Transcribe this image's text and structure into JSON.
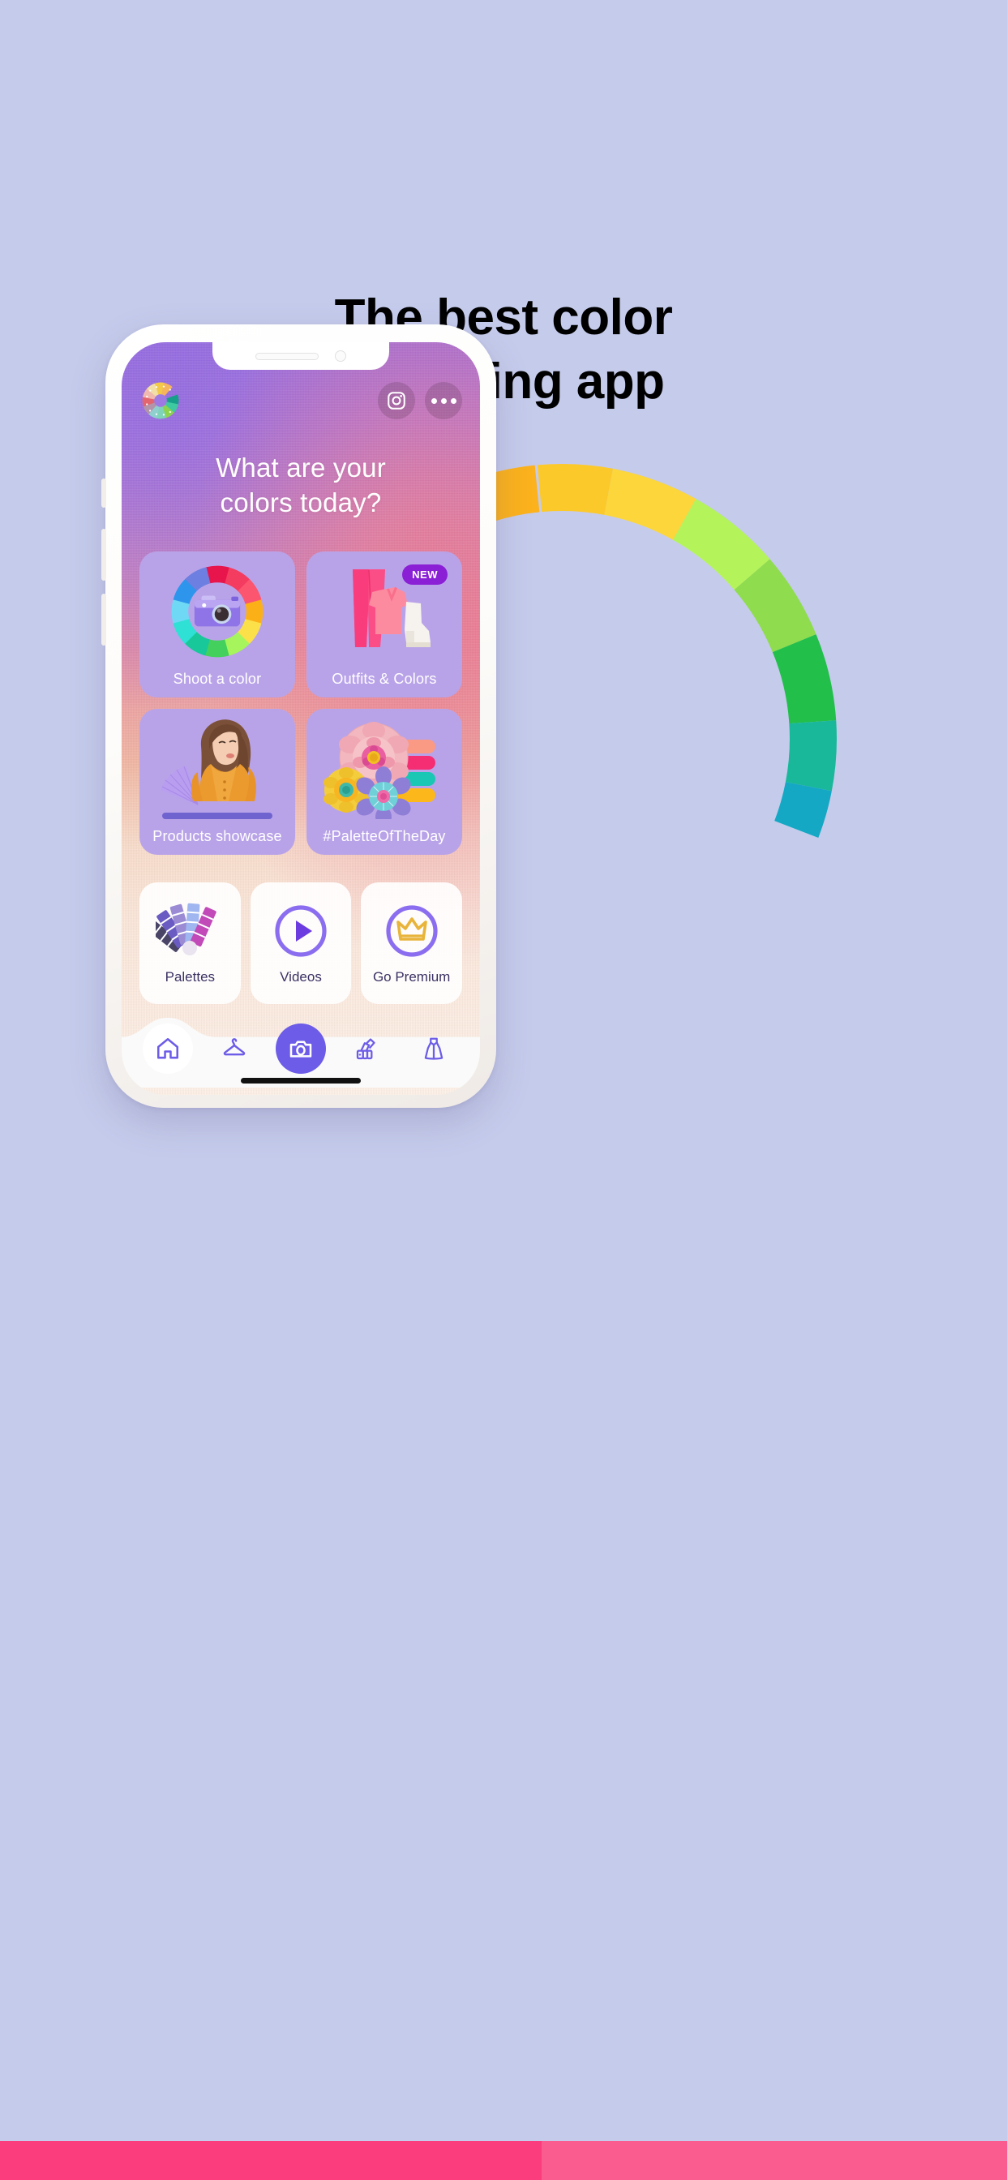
{
  "page": {
    "background_color": "#c5cbeb",
    "headline": "The best color\nmatching app"
  },
  "bottom_strip": {
    "left_color": "#fb3c7d",
    "right_color": "#fb5c90"
  },
  "wheel_arc": {
    "name": "color-wheel-arc",
    "segments": [
      "#e6175b",
      "#f4236e",
      "#fb3c7d",
      "#fcb21c",
      "#fcc92b",
      "#fcd63b",
      "#b4f45a",
      "#8fdc4e",
      "#22bf4b",
      "#19b89a",
      "#14a8c4"
    ]
  },
  "phone": {
    "notch": {
      "speaker": "speaker-grille",
      "camera": "front-camera"
    },
    "screen": {
      "topbar": {
        "logo_name": "color-wheel-logo",
        "instagram_label": "Instagram",
        "more_label": "More options"
      },
      "hero_title": "What are your\ncolors today?",
      "tiles": [
        {
          "label": "Shoot a color",
          "icon": "color-wheel-camera-icon",
          "badge": null
        },
        {
          "label": "Outfits & Colors",
          "icon": "outfit-icon",
          "badge": "NEW"
        },
        {
          "label": "Products showcase",
          "icon": "model-photo-icon",
          "badge": null
        },
        {
          "label": "#PaletteOfTheDay",
          "icon": "paper-flowers-icon",
          "badge": null
        }
      ],
      "mini_cards": [
        {
          "label": "Palettes",
          "icon": "palette-fandeck-icon"
        },
        {
          "label": "Videos",
          "icon": "play-circle-icon"
        },
        {
          "label": "Go Premium",
          "icon": "crown-circle-icon"
        }
      ],
      "bottom_nav": [
        {
          "name": "home",
          "icon": "home-icon",
          "active": true
        },
        {
          "name": "wardrobe",
          "icon": "hanger-icon",
          "active": false
        },
        {
          "name": "camera",
          "icon": "camera-icon",
          "active": false
        },
        {
          "name": "palettes",
          "icon": "palette-fan-icon",
          "active": false
        },
        {
          "name": "outfits",
          "icon": "dress-icon",
          "active": false
        }
      ]
    }
  },
  "colors": {
    "accent_purple": "#6c5ce7",
    "tile_purple": "#b9a3e8",
    "badge_purple": "#8a1fd6",
    "mini_label": "#3b3163",
    "crown_gold": "#e8b43a"
  }
}
